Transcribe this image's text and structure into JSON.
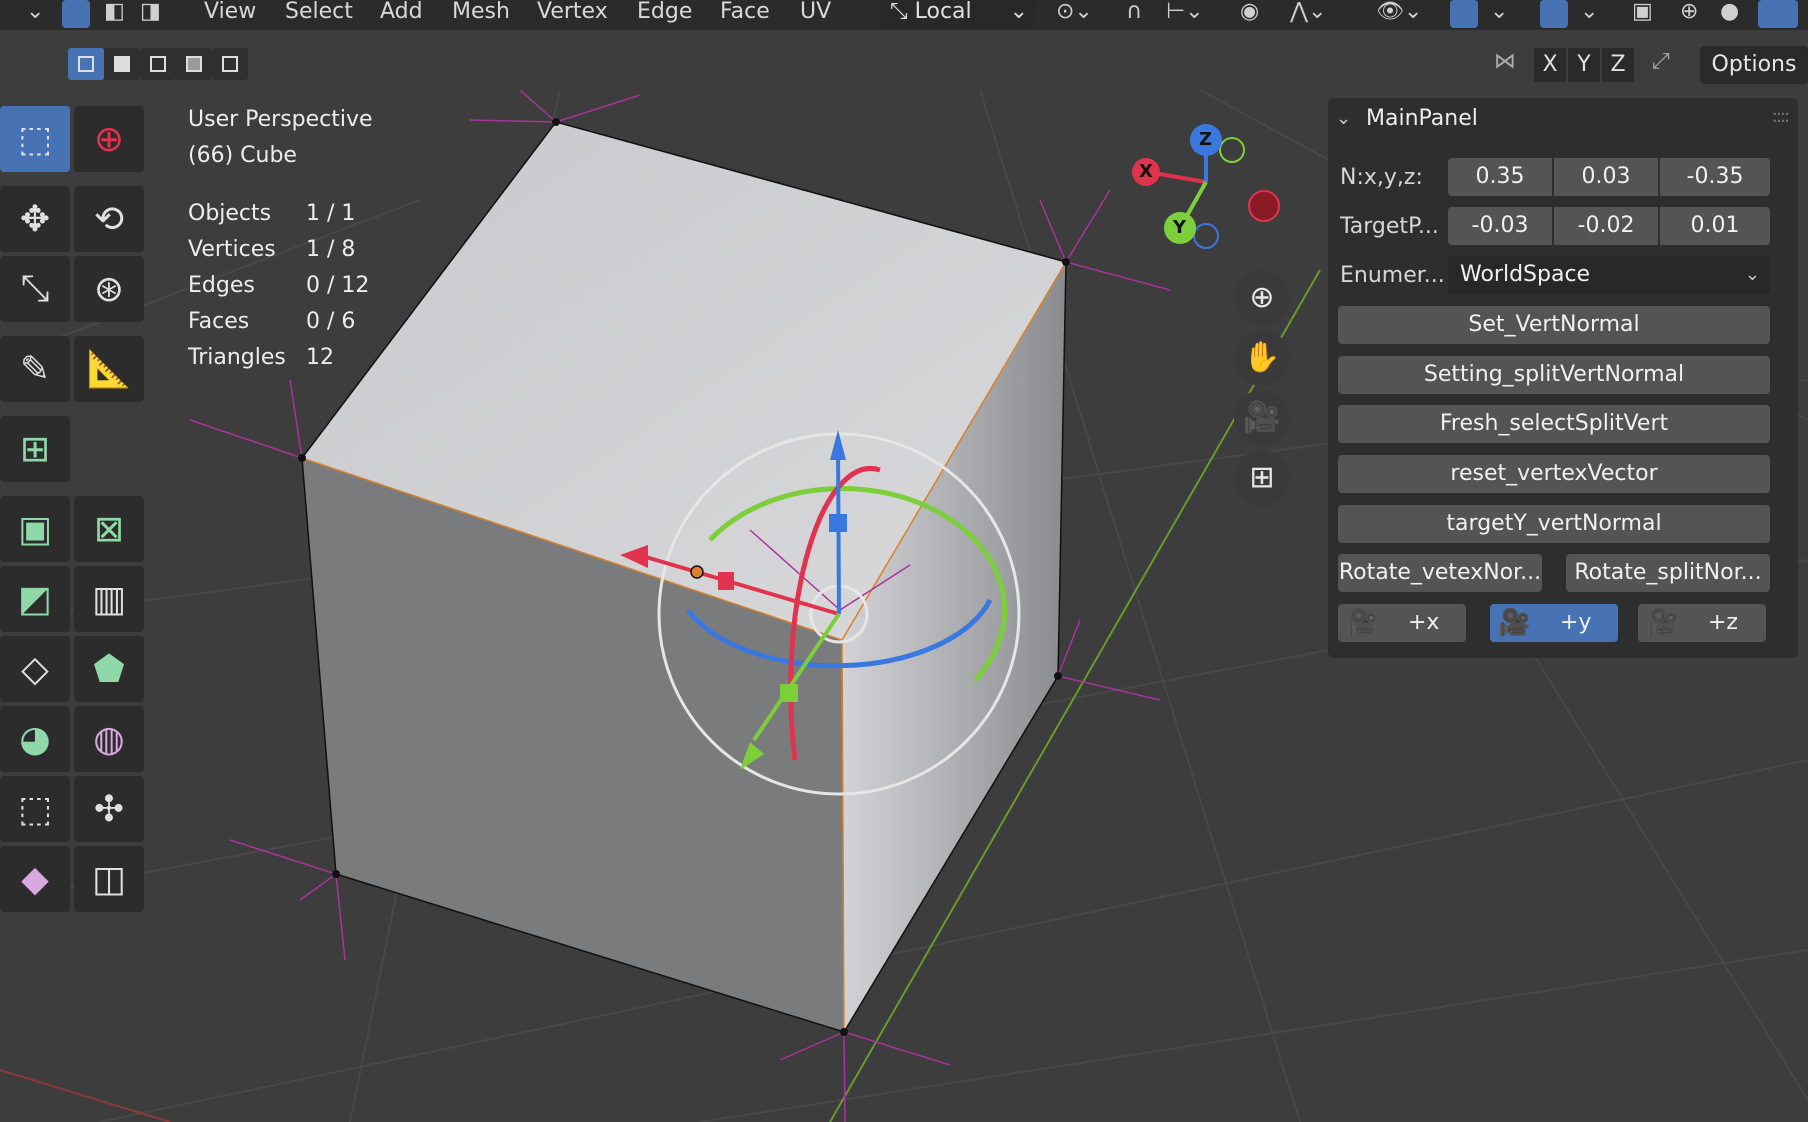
{
  "header": {
    "menus": [
      "View",
      "Select",
      "Add",
      "Mesh",
      "Vertex",
      "Edge",
      "Face",
      "UV"
    ],
    "orientation": "Local",
    "axes": [
      "X",
      "Y",
      "Z"
    ],
    "options_label": "Options"
  },
  "viewport": {
    "title": "User Perspective",
    "object": "(66) Cube",
    "stats": [
      {
        "label": "Objects",
        "value": "1 / 1"
      },
      {
        "label": "Vertices",
        "value": "1 / 8"
      },
      {
        "label": "Edges",
        "value": "0 / 12"
      },
      {
        "label": "Faces",
        "value": "0 / 6"
      },
      {
        "label": "Triangles",
        "value": "12"
      }
    ],
    "gizmo_axes": {
      "x": "X",
      "y": "Y",
      "z": "Z"
    }
  },
  "panel": {
    "title": "MainPanel",
    "normal_label": "N:x,y,z:",
    "normal_values": [
      "0.35",
      "0.03",
      "-0.35"
    ],
    "target_label": "TargetP...",
    "target_values": [
      "-0.03",
      "-0.02",
      "0.01"
    ],
    "enum_label": "Enumer...",
    "enum_value": "WorldSpace",
    "buttons": [
      "Set_VertNormal",
      "Setting_splitVertNormal",
      "Fresh_selectSplitVert",
      "reset_vertexVector",
      "targetY_vertNormal"
    ],
    "rotate_vertex": "Rotate_vetexNor...",
    "rotate_split": "Rotate_splitNor...",
    "view_buttons": [
      "+x",
      "+y",
      "+z"
    ]
  },
  "colors": {
    "accent": "#4772b3",
    "x_axis": "#e0344e",
    "y_axis": "#7ccf3a",
    "z_axis": "#3a78e0"
  }
}
